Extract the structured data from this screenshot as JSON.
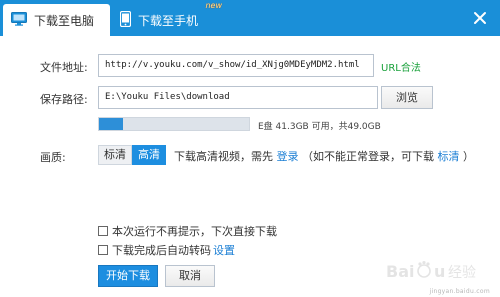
{
  "tabs": {
    "pc_label": "下载至电脑",
    "phone_label": "下载至手机",
    "new_badge": "new"
  },
  "form": {
    "url_label": "文件地址:",
    "url_value": "http://v.youku.com/v_show/id_XNjg0MDEyMDM2.html",
    "url_status": "URL合法",
    "path_label": "保存路径:",
    "path_value": "E:\\Youku Files\\download",
    "browse_label": "浏览"
  },
  "disk": {
    "used_fraction": 0.16,
    "text": "E盘 41.3GB 可用，共49.0GB"
  },
  "quality": {
    "label": "画质:",
    "sd_label": "标清",
    "hd_label": "高清",
    "note_prefix": "下载高清视频，需先",
    "login_link": "登录",
    "note_middle": "（如不能正常登录，可下载",
    "sd_link": "标清",
    "note_suffix": "）"
  },
  "options": {
    "no_prompt_label": "本次运行不再提示，下次直接下载",
    "no_prompt_checked": false,
    "auto_transcode_label": "下载完成后自动转码",
    "settings_link": "设置",
    "auto_transcode_checked": false
  },
  "buttons": {
    "start_label": "开始下载",
    "cancel_label": "取消"
  },
  "colors": {
    "brand_blue": "#1a8fd8",
    "selected_blue": "#1d8ee0",
    "valid_green": "#1aa13b",
    "link_blue": "#1a7ed4"
  },
  "icons": {
    "pc_tab": "monitor-icon",
    "phone_tab": "smartphone-icon",
    "close": "close-icon"
  },
  "watermark": {
    "brand": "Baidu",
    "brand_cn": "经验",
    "url": "jingyan.baidu.com"
  }
}
